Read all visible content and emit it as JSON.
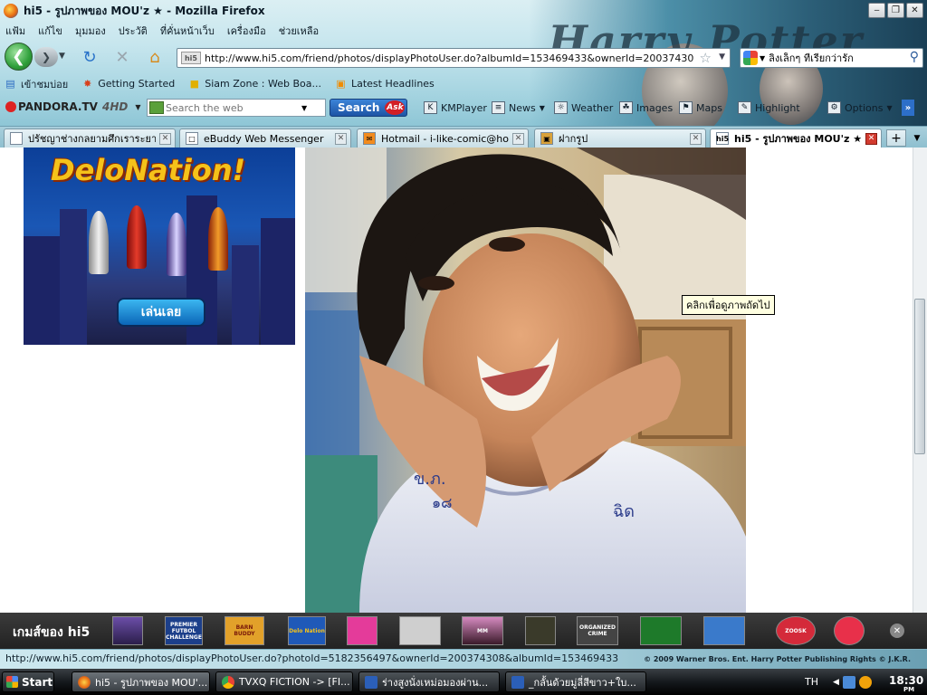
{
  "window": {
    "title": "hi5 - รูปภาพของ MOU'z ★ - Mozilla Firefox"
  },
  "menu": [
    "แฟ้ม",
    "แก้ไข",
    "มุมมอง",
    "ประวัติ",
    "ที่คั่นหน้าเว็บ",
    "เครื่องมือ",
    "ช่วยเหลือ"
  ],
  "nav": {
    "url": "http://www.hi5.com/friend/photos/displayPhotoUser.do?albumId=153469433&ownerId=200374308&photoId=5",
    "search_value": "ลิงเล็กๆ ที่เรียกว่ารัก",
    "site_badge": "hi5"
  },
  "bookmarks": [
    "เข้าชมบ่อย",
    "Getting Started",
    "Siam Zone : Web Boa...",
    "Latest Headlines"
  ],
  "toolbar2": {
    "brand": "PANDORA.TV",
    "brand_suffix": "4HD",
    "search_placeholder": "Search the web",
    "search_button": "Search",
    "ask_logo": "Ask",
    "items": [
      "KMPlayer",
      "News",
      "Weather",
      "Images",
      "Maps",
      "Highlight",
      "Options"
    ]
  },
  "theme": {
    "title": "Harry Potter"
  },
  "tabs": [
    {
      "label": "ปรัชญาช่างกลยามศึกเราระยา...",
      "active": false
    },
    {
      "label": "eBuddy Web Messenger",
      "active": false
    },
    {
      "label": "Hotmail - i-like-comic@hotm...",
      "active": false
    },
    {
      "label": "ฝากรูป",
      "active": false
    },
    {
      "label": "hi5 - รูปภาพของ MOU'z ★",
      "active": true
    }
  ],
  "page": {
    "ad_logo": "DeloNation!",
    "ad_button": "เล่นเลย",
    "tooltip": "คลิกเพื่อดูภาพถัดไป",
    "shirt_text_left": "ข.ภ.",
    "shirt_text_left2": "๑๘",
    "shirt_text_right": "ฉิด"
  },
  "games_bar": {
    "title": "เกมส์ของ hi5",
    "games": [
      "",
      "PREMIER FUTBOL CHALLENGE",
      "BARN BUDDY",
      "Delo Nation",
      "",
      "",
      "MM",
      "",
      "ORGANIZED CRIME",
      "",
      "",
      "ZOOSK",
      ""
    ]
  },
  "status": {
    "url": "http://www.hi5.com/friend/photos/displayPhotoUser.do?photoId=5182356497&ownerId=200374308&albumId=153469433",
    "copyright": "© 2009 Warner Bros. Ent. Harry Potter Publishing Rights © J.K.R."
  },
  "taskbar": {
    "start": "Start",
    "tasks": [
      {
        "label": "hi5 - รูปภาพของ MOU'...",
        "active": true
      },
      {
        "label": "TVXQ FICTION -> [FI...",
        "active": false
      },
      {
        "label": "ร่างสูงนั่งเหม่อมองผ่าน...",
        "active": false
      },
      {
        "label": "_กลั้นด้วยมู่ลี่สีขาว+ใบ...",
        "active": false
      }
    ],
    "lang": "TH",
    "clock": "18:30",
    "ampm": "PM"
  },
  "colors": {
    "chrome_gradient_top": "#dbeff3",
    "chrome_gradient_bottom": "#7fbdcf",
    "games_bar": "#2b2b2b",
    "taskbar": "#15191d",
    "tooltip_bg": "#ffffe1"
  }
}
